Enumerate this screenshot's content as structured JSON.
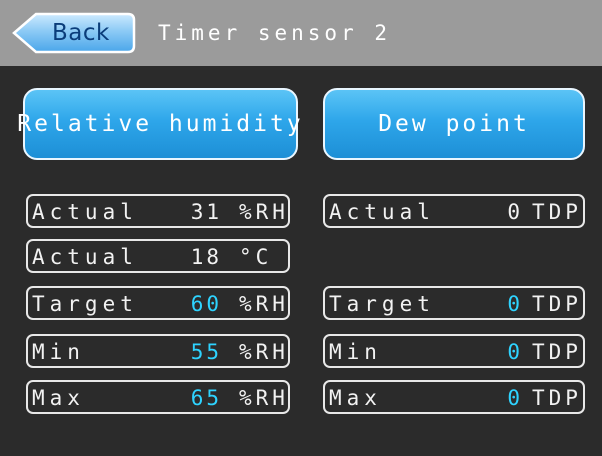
{
  "header": {
    "back_label": "Back",
    "title": "Timer sensor 2"
  },
  "modes": {
    "relative_humidity_label": "Relative humidity",
    "dew_point_label": "Dew point"
  },
  "humidity": {
    "actual": {
      "label": "Actual",
      "value": "31",
      "unit": "%RH"
    },
    "actual_temp": {
      "label": "Actual",
      "value": "18",
      "unit": "°C"
    },
    "target": {
      "label": "Target",
      "value": "60",
      "unit": "%RH"
    },
    "min": {
      "label": "Min",
      "value": "55",
      "unit": "%RH"
    },
    "max": {
      "label": "Max",
      "value": "65",
      "unit": "%RH"
    }
  },
  "dew_point": {
    "actual": {
      "label": "Actual",
      "value": "0",
      "unit": "TDP"
    },
    "target": {
      "label": "Target",
      "value": "0",
      "unit": "TDP"
    },
    "min": {
      "label": "Min",
      "value": "0",
      "unit": "TDP"
    },
    "max": {
      "label": "Max",
      "value": "0",
      "unit": "TDP"
    }
  },
  "colors": {
    "header_bg": "#9b9b9b",
    "screen_bg": "#2b2b2b",
    "button_blue": "#2ea6ea",
    "editable_value": "#2ed3ff"
  }
}
